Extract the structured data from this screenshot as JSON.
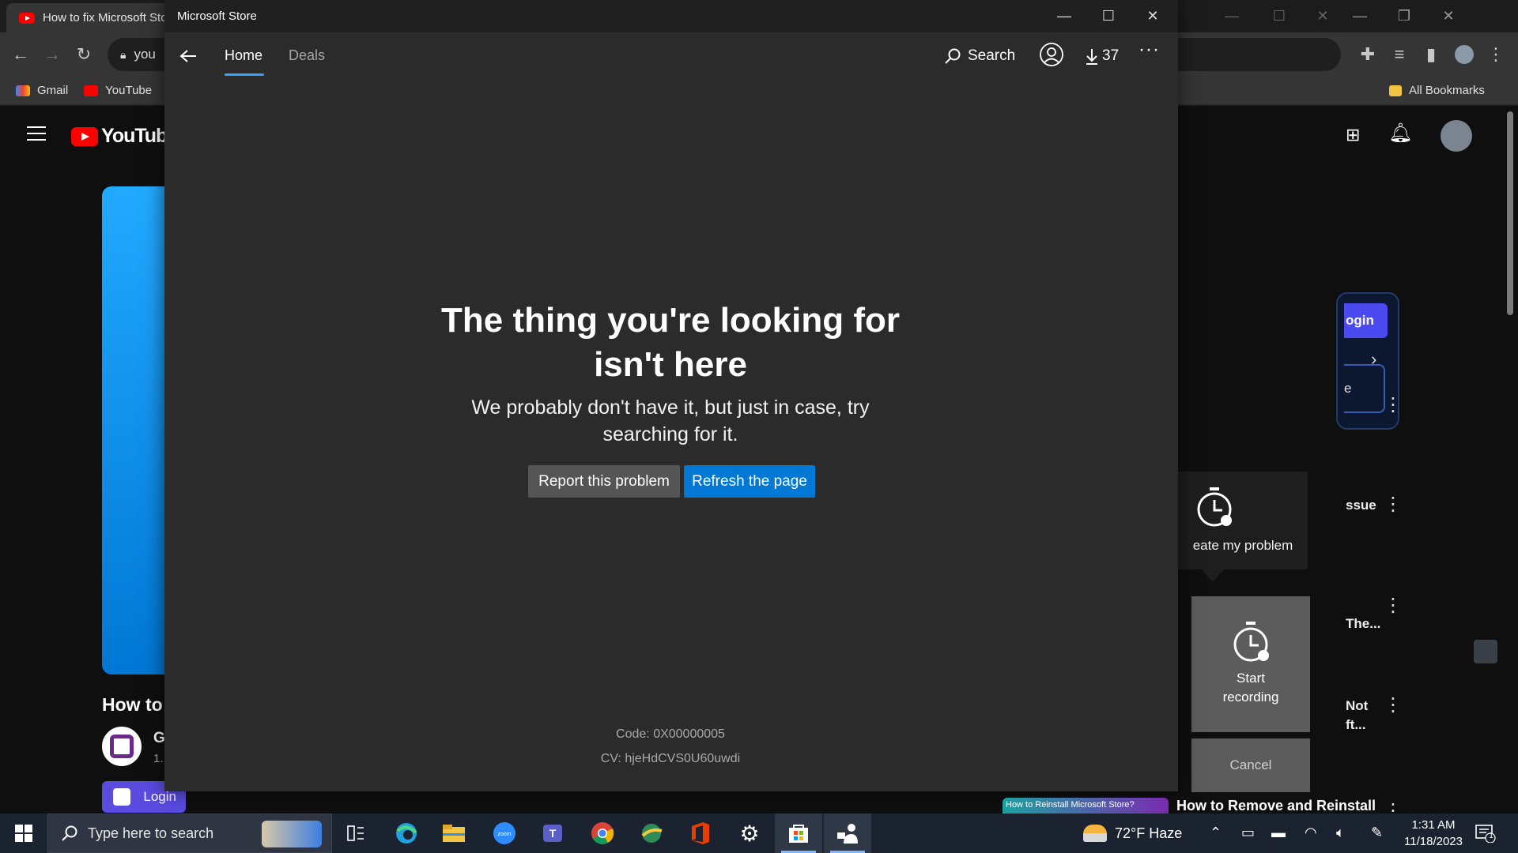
{
  "chrome": {
    "tab_title": "How to fix Microsoft Store",
    "omnibox_text": "you",
    "bookmarks": [
      {
        "label": "Gmail"
      },
      {
        "label": "YouTube"
      }
    ],
    "all_bookmarks_label": "All Bookmarks"
  },
  "youtube": {
    "logo_text": "YouTube",
    "video_title": "How to",
    "channel_initial": "G",
    "channel_meta": "1.",
    "login_bottom": "Login",
    "login_right": "ogin",
    "box_right": "e",
    "side_titles": [
      "ssue",
      "The...",
      "Not",
      "ft..."
    ],
    "bottom_thumb_text": "How to Reinstall Microsoft Store?",
    "bottom_title": "How to Remove and Reinstall"
  },
  "recorder": {
    "create_label": "eate my problem",
    "start_label_line1": "Start",
    "start_label_line2": "recording",
    "cancel_label": "Cancel"
  },
  "store": {
    "app_title": "Microsoft Store",
    "tabs": [
      {
        "label": "Home",
        "active": true
      },
      {
        "label": "Deals",
        "active": false
      }
    ],
    "search_label": "Search",
    "downloads_count": "37",
    "error_title_line1": "The thing you're looking for",
    "error_title_line2": "isn't here",
    "error_subtitle_line1": "We probably don't have it, but just in case, try",
    "error_subtitle_line2": "searching for it.",
    "report_button": "Report this problem",
    "refresh_button": "Refresh the page",
    "code": "Code: 0X00000005",
    "cv": "CV: hjeHdCVS0U60uwdi"
  },
  "taskbar": {
    "search_placeholder": "Type here to search",
    "weather": "72°F  Haze",
    "time": "1:31 AM",
    "date": "11/18/2023",
    "notification_count": "1"
  },
  "colors": {
    "store_bg": "#2b2b2b",
    "accent_blue": "#0078d4",
    "secondary_button": "#555555",
    "taskbar_bg": "#1c2330"
  }
}
